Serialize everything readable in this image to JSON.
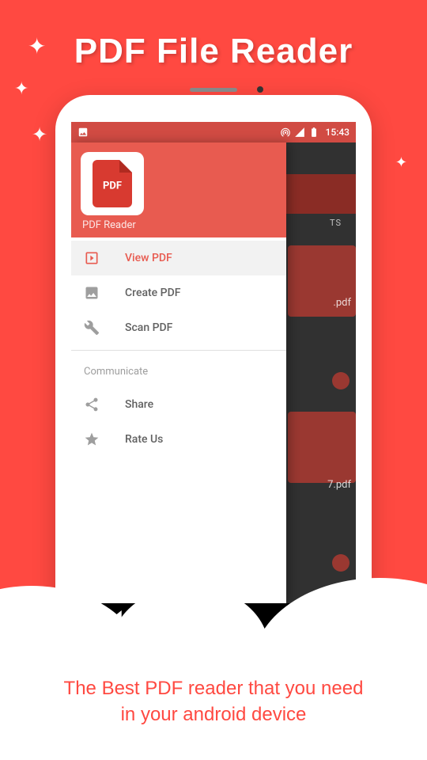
{
  "header": {
    "title": "PDF File Reader"
  },
  "status": {
    "time": "15:43"
  },
  "drawer": {
    "header_label": "PDF Reader",
    "app_icon_text": "PDF",
    "items": [
      {
        "label": "View PDF"
      },
      {
        "label": "Create PDF"
      },
      {
        "label": "Scan PDF"
      }
    ],
    "subheader": "Communicate",
    "comm_items": [
      {
        "label": "Share"
      },
      {
        "label": "Rate Us"
      }
    ]
  },
  "bg": {
    "tab": "TS",
    "file1": ".pdf",
    "file2": "7.pdf"
  },
  "tagline": {
    "line1": "The Best PDF reader that you need",
    "line2": "in your android device"
  }
}
